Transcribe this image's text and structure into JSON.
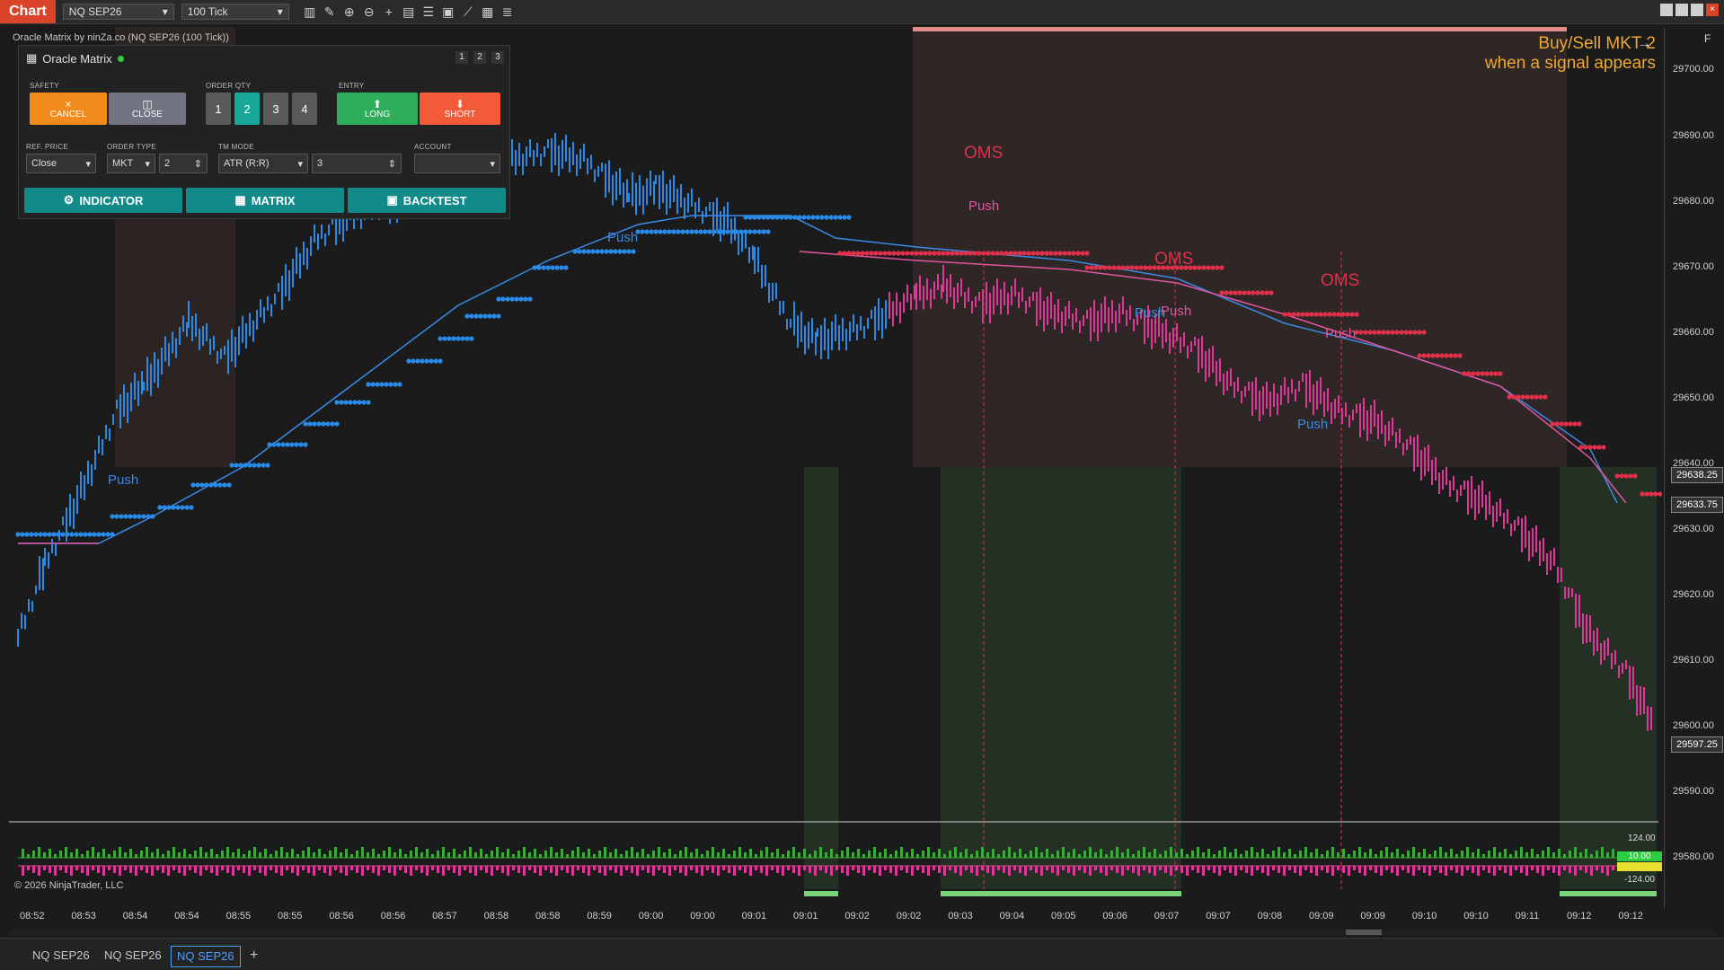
{
  "toolbar": {
    "chart_tag": "Chart",
    "instrument": "NQ SEP26",
    "interval": "100 Tick",
    "icons": [
      "bar-chart-icon",
      "pencil-icon",
      "zoom-in-icon",
      "zoom-out-icon",
      "crosshair-icon",
      "properties-icon",
      "strategy-icon",
      "data-box-icon",
      "drawing-tool-icon",
      "calculator-icon",
      "list-icon"
    ],
    "window_buttons": [
      "",
      "",
      "",
      "×"
    ]
  },
  "chart_title": "Oracle Matrix by ninZa.co (NQ SEP26 (100 Tick))",
  "panel": {
    "title": "Oracle Matrix",
    "pages": [
      "1",
      "2",
      "3"
    ],
    "safety_label": "SAFETY",
    "cancel_label": "CANCEL",
    "close_label": "CLOSE",
    "order_qty_label": "ORDER QTY",
    "qty_options": [
      "1",
      "2",
      "3",
      "4"
    ],
    "qty_selected": 1,
    "entry_label": "ENTRY",
    "long_label": "LONG",
    "short_label": "SHORT",
    "ref_price_label": "REF. PRICE",
    "ref_price_value": "Close",
    "order_type_label": "ORDER TYPE",
    "order_type_value": "MKT",
    "order_type_offset": "2",
    "tm_mode_label": "TM MODE",
    "tm_mode_value": "ATR (R:R)",
    "tm_mode_param": "3",
    "account_label": "ACCOUNT",
    "account_value": "",
    "indicator_label": "INDICATOR",
    "matrix_label": "MATRIX",
    "backtest_label": "BACKTEST",
    "colors": {
      "cancel": "#f28a1c",
      "close": "#6f7480",
      "qty_active": "#17a89a",
      "long": "#2eae5a",
      "short": "#f25a3a",
      "teal": "#128a8a"
    }
  },
  "overlay": {
    "line1": "Buy/Sell MKT 2",
    "line2": "when a signal appears"
  },
  "signals": [
    {
      "text": "Push",
      "color": "#3a8ae8"
    },
    {
      "text": "Push",
      "color": "#3a8ae8"
    },
    {
      "text": "OMS",
      "color": "#e0304a"
    },
    {
      "text": "Push",
      "color": "#e055a0"
    },
    {
      "text": "OMS",
      "color": "#e0304a"
    },
    {
      "text": "Push",
      "color": "#3a8ae8"
    },
    {
      "text": "Push",
      "color": "#e055a0"
    },
    {
      "text": "OMS",
      "color": "#e0304a"
    },
    {
      "text": "Push",
      "color": "#e055a0"
    },
    {
      "text": "Push",
      "color": "#3a8ae8"
    }
  ],
  "price_axis": {
    "top_label": "F",
    "labels": [
      "29700.00",
      "29690.00",
      "29680.00",
      "29670.00",
      "29660.00",
      "29650.00",
      "29640.00",
      "29630.00",
      "29620.00",
      "29610.00",
      "29600.00",
      "29590.00",
      "29580.00"
    ],
    "markers": [
      {
        "value": "29638.25",
        "bg": "#333"
      },
      {
        "value": "29633.75",
        "bg": "#333"
      },
      {
        "value": "29597.25",
        "bg": "#333"
      }
    ],
    "osc_labels": [
      "124.00",
      "10.00",
      "-124.00"
    ]
  },
  "time_axis": [
    "08:52",
    "08:53",
    "08:54",
    "08:54",
    "08:55",
    "08:55",
    "08:56",
    "08:56",
    "08:57",
    "08:58",
    "08:58",
    "08:59",
    "09:00",
    "09:00",
    "09:01",
    "09:01",
    "09:02",
    "09:02",
    "09:03",
    "09:04",
    "09:05",
    "09:06",
    "09:07",
    "09:07",
    "09:08",
    "09:09",
    "09:09",
    "09:10",
    "09:10",
    "09:11",
    "09:12",
    "09:12"
  ],
  "copyright": "© 2026 NinjaTrader, LLC",
  "tabs": [
    "NQ SEP26",
    "NQ SEP26",
    "NQ SEP26"
  ],
  "active_tab": 2,
  "add_tab": "+",
  "colors": {
    "bull": "#2a8ae8",
    "bear": "#e0389a",
    "stop_bear": "#e0304a",
    "bg": "#1b1b1b"
  }
}
